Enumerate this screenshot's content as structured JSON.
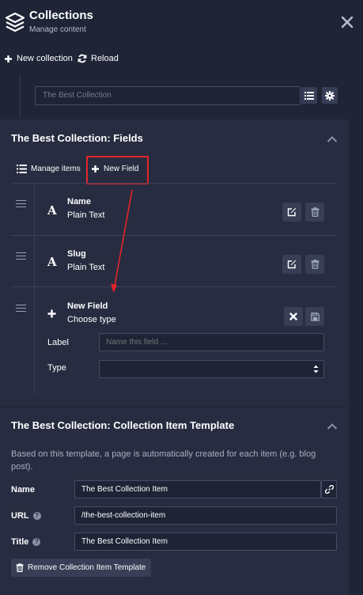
{
  "header": {
    "title": "Collections",
    "subtitle": "Manage content"
  },
  "toolbar": {
    "new_collection": "New collection",
    "reload": "Reload"
  },
  "collection_select": {
    "value": "The Best Collection"
  },
  "fields_panel": {
    "title": "The Best Collection: Fields",
    "manage_items": "Manage items",
    "new_field": "New Field",
    "fields": [
      {
        "name": "Name",
        "type": "Plain Text"
      },
      {
        "name": "Slug",
        "type": "Plain Text"
      }
    ],
    "new_field_form": {
      "title": "New Field",
      "subtitle": "Choose type",
      "label_label": "Label",
      "label_placeholder": "Name this field ...",
      "type_label": "Type",
      "type_value": ""
    }
  },
  "template_panel": {
    "title": "The Best Collection: Collection Item Template",
    "description_line1": "Based on this template, a page is automatically created for each item (e.g. blog",
    "description_line2": "post).",
    "name_label": "Name",
    "name_value": "The Best Collection Item",
    "url_label": "URL",
    "url_value": "/the-best-collection-item",
    "title_label": "Title",
    "title_value": "The Best Collection Item",
    "remove_button": "Remove Collection Item Template"
  },
  "colors": {
    "background": "#1f2437",
    "panel": "#272c40",
    "button": "#373e55",
    "annotation": "#e3262b"
  }
}
